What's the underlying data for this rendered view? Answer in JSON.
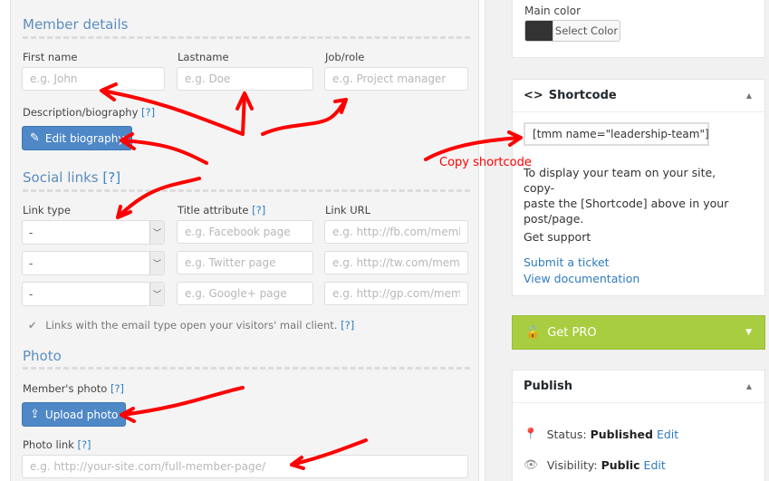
{
  "member_details": {
    "title": "Member details",
    "first_name": {
      "label": "First name",
      "placeholder": "e.g. John",
      "value": ""
    },
    "last_name": {
      "label": "Lastname",
      "placeholder": "e.g. Doe",
      "value": ""
    },
    "job_role": {
      "label": "Job/role",
      "placeholder": "e.g. Project manager",
      "value": ""
    },
    "description_label": "Description/biography",
    "edit_biography_button": "Edit biography"
  },
  "social_links": {
    "title": "Social links",
    "help": "[?]",
    "columns": {
      "link_type": "Link type",
      "title_attribute": "Title attribute",
      "link_url": "Link URL"
    },
    "rows": [
      {
        "type": "-",
        "title_placeholder": "e.g. Facebook page",
        "url_placeholder": "e.g. http://fb.com/member"
      },
      {
        "type": "-",
        "title_placeholder": "e.g. Twitter page",
        "url_placeholder": "e.g. http://tw.com/member"
      },
      {
        "type": "-",
        "title_placeholder": "e.g. Google+ page",
        "url_placeholder": "e.g. http://gp.com/member"
      }
    ],
    "note": "Links with the email type open your visitors' mail client."
  },
  "photo": {
    "title": "Photo",
    "members_photo_label": "Member's photo",
    "upload_button": "Upload photo",
    "photo_link_label": "Photo link",
    "photo_link_placeholder": "e.g. http://your-site.com/full-member-page/"
  },
  "help_marker": "[?]",
  "sidebar": {
    "main_color": {
      "label": "Main color",
      "button": "Select Color",
      "value": "#333333"
    },
    "shortcode": {
      "title": "Shortcode",
      "value": "[tmm name=\"leadership-team\"]",
      "description_line1": "To display your team on your site, copy-",
      "description_line2": "paste the [Shortcode] above in your",
      "description_line3": "post/page.",
      "support_heading": "Get support",
      "submit_ticket": "Submit a ticket",
      "view_documentation": "View documentation"
    },
    "get_pro": {
      "label": "Get PRO",
      "color": "#a9cd40"
    },
    "publish": {
      "title": "Publish",
      "status_label": "Status:",
      "status_value": "Published",
      "visibility_label": "Visibility:",
      "visibility_value": "Public",
      "edit": "Edit"
    }
  },
  "annotations": {
    "copy_shortcode": "Copy shortcode",
    "arrow_color": "#ff0000"
  }
}
